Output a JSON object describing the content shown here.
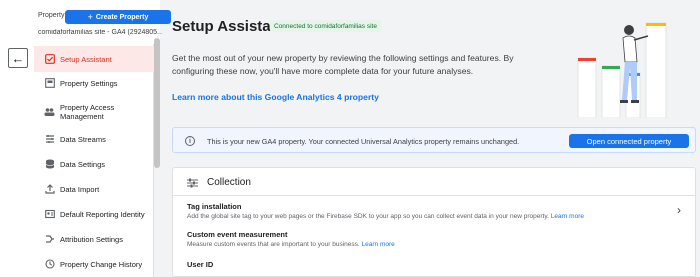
{
  "property": {
    "label": "Property",
    "create_button": "Create Property",
    "name": "comidaforfamilias site - GA4 (2924805..."
  },
  "sidebar": {
    "items": [
      {
        "label": "Setup Assistant",
        "icon": "checkbox-icon",
        "active": true
      },
      {
        "label": "Property Settings",
        "icon": "settings-card-icon"
      },
      {
        "label": "Property Access\nManagement",
        "icon": "people-icon"
      },
      {
        "label": "Data Streams",
        "icon": "streams-icon"
      },
      {
        "label": "Data Settings",
        "icon": "database-icon"
      },
      {
        "label": "Data Import",
        "icon": "upload-icon"
      },
      {
        "label": "Default Reporting Identity",
        "icon": "identity-icon"
      },
      {
        "label": "Attribution Settings",
        "icon": "attribution-icon"
      },
      {
        "label": "Property Change History",
        "icon": "history-icon"
      }
    ]
  },
  "main": {
    "title": "Setup Assistant",
    "badge": "Connected to comidaforfamilias site",
    "intro": "Get the most out of your new property by reviewing the following settings and features. By configuring these now, you'll have more complete data for your future analyses.",
    "learn_more": "Learn more about this Google Analytics 4 property",
    "banner": {
      "message": "This is your new GA4 property. Your connected Universal Analytics property remains unchanged.",
      "button": "Open connected property"
    },
    "collection": {
      "title": "Collection",
      "rows": [
        {
          "title": "Tag installation",
          "desc": "Add the global site tag to your web pages or the Firebase SDK to your app so you can collect event data in your new property.",
          "link": "Learn more"
        },
        {
          "title": "Custom event measurement",
          "desc": "Measure custom events that are important to your business.",
          "link": "Learn more"
        },
        {
          "title": "User ID",
          "desc": "",
          "link": ""
        }
      ]
    }
  },
  "colors": {
    "accent": "#1a73e8",
    "active_nav": "#d93025",
    "badge_green": "#137333"
  }
}
